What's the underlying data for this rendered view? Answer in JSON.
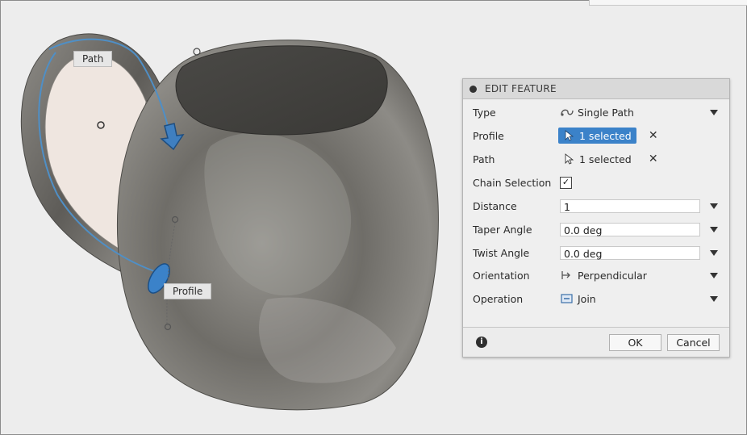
{
  "viewport": {
    "path_label": "Path",
    "profile_label": "Profile"
  },
  "panel": {
    "title": "EDIT FEATURE",
    "rows": {
      "type": {
        "label": "Type",
        "value": "Single Path",
        "icon": "single-path-icon"
      },
      "profile": {
        "label": "Profile",
        "value": "1 selected",
        "icon": "select-cursor-icon"
      },
      "path": {
        "label": "Path",
        "value": "1 selected",
        "icon": "select-cursor-icon"
      },
      "chain": {
        "label": "Chain Selection",
        "checked": true,
        "check_glyph": "✓"
      },
      "distance": {
        "label": "Distance",
        "value": "1"
      },
      "taper": {
        "label": "Taper Angle",
        "value": "0.0 deg"
      },
      "twist": {
        "label": "Twist Angle",
        "value": "0.0 deg"
      },
      "orientation": {
        "label": "Orientation",
        "value": "Perpendicular",
        "icon": "perpendicular-icon"
      },
      "operation": {
        "label": "Operation",
        "value": "Join",
        "icon": "join-icon"
      }
    },
    "clear_glyph": "✕",
    "info_glyph": "i",
    "ok_label": "OK",
    "cancel_label": "Cancel"
  },
  "colors": {
    "selection_blue": "#3b82c9",
    "path_line": "#4f8fc6",
    "mug_gray": "#7f7d78"
  }
}
